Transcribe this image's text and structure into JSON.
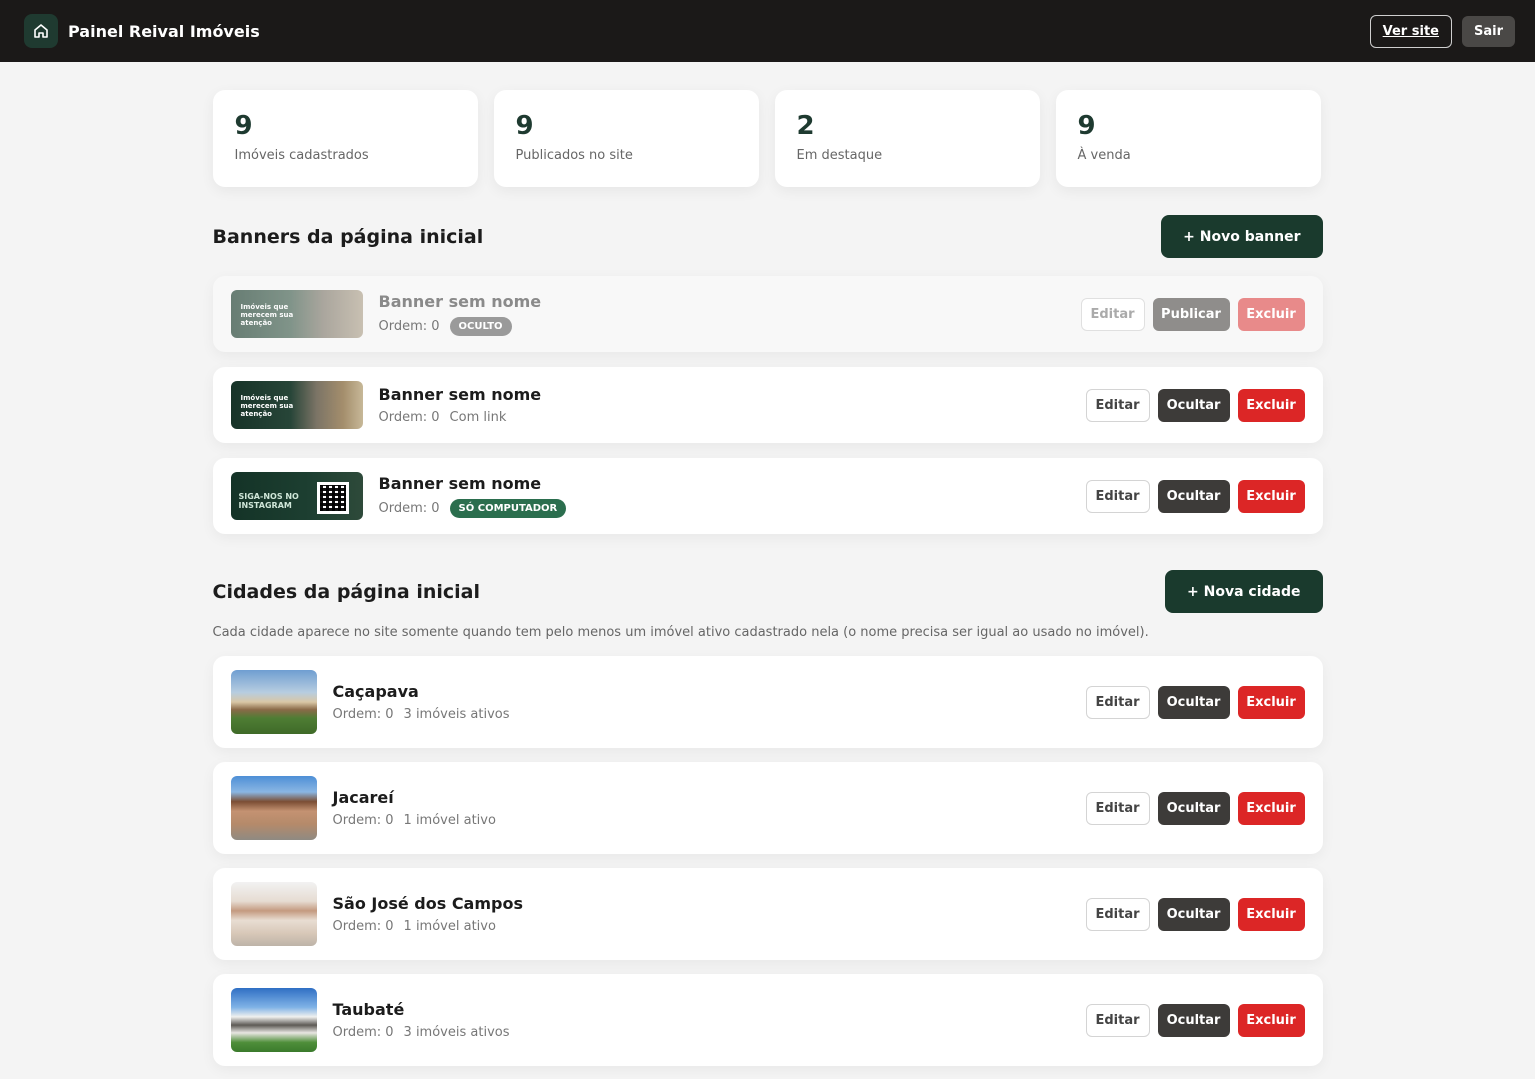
{
  "header": {
    "title": "Painel Reival Imóveis",
    "view_site": "Ver site",
    "logout": "Sair"
  },
  "stats": [
    {
      "value": "9",
      "label": "Imóveis cadastrados"
    },
    {
      "value": "9",
      "label": "Publicados no site"
    },
    {
      "value": "2",
      "label": "Em destaque"
    },
    {
      "value": "9",
      "label": "À venda"
    }
  ],
  "banners": {
    "title": "Banners da página inicial",
    "new_button": "+ Novo banner",
    "items": [
      {
        "name": "Banner sem nome",
        "order": "Ordem: 0",
        "badge": "OCULTO",
        "extra": "",
        "edit": "Editar",
        "toggle": "Publicar",
        "delete": "Excluir",
        "thumb_text": "Imóveis que merecem sua atenção"
      },
      {
        "name": "Banner sem nome",
        "order": "Ordem: 0",
        "badge": "",
        "extra": "Com link",
        "edit": "Editar",
        "toggle": "Ocultar",
        "delete": "Excluir",
        "thumb_text": "Imóveis que merecem sua atenção"
      },
      {
        "name": "Banner sem nome",
        "order": "Ordem: 0",
        "badge": "SÓ COMPUTADOR",
        "extra": "",
        "edit": "Editar",
        "toggle": "Ocultar",
        "delete": "Excluir",
        "thumb_text": "SIGA-NOS NO INSTAGRAM"
      }
    ]
  },
  "cities": {
    "title": "Cidades da página inicial",
    "new_button": "+ Nova cidade",
    "description": "Cada cidade aparece no site somente quando tem pelo menos um imóvel ativo cadastrado nela (o nome precisa ser igual ao usado no imóvel).",
    "items": [
      {
        "name": "Caçapava",
        "order": "Ordem: 0",
        "count": "3 imóveis ativos",
        "edit": "Editar",
        "toggle": "Ocultar",
        "delete": "Excluir"
      },
      {
        "name": "Jacareí",
        "order": "Ordem: 0",
        "count": "1 imóvel ativo",
        "edit": "Editar",
        "toggle": "Ocultar",
        "delete": "Excluir"
      },
      {
        "name": "São José dos Campos",
        "order": "Ordem: 0",
        "count": "1 imóvel ativo",
        "edit": "Editar",
        "toggle": "Ocultar",
        "delete": "Excluir"
      },
      {
        "name": "Taubaté",
        "order": "Ordem: 0",
        "count": "3 imóveis ativos",
        "edit": "Editar",
        "toggle": "Ocultar",
        "delete": "Excluir"
      }
    ]
  }
}
